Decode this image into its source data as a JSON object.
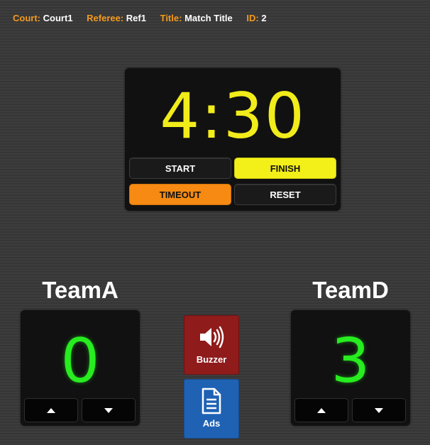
{
  "info": {
    "court_label": "Court:",
    "court_value": "Court1",
    "referee_label": "Referee:",
    "referee_value": "Ref1",
    "title_label": "Title:",
    "title_value": "Match Title",
    "id_label": "ID:",
    "id_value": "2"
  },
  "timer": {
    "display": "4:30",
    "start_label": "START",
    "finish_label": "FINISH",
    "timeout_label": "TIMEOUT",
    "reset_label": "RESET"
  },
  "team_left": {
    "name": "TeamA",
    "score": "0"
  },
  "team_right": {
    "name": "TeamD",
    "score": "3"
  },
  "actions": {
    "buzzer_label": "Buzzer",
    "buzzer_icon": "speaker-icon",
    "ads_label": "Ads",
    "ads_icon": "document-icon"
  },
  "colors": {
    "accent_orange": "#f39a1e",
    "clock_yellow": "#f1ec1a",
    "score_green": "#27ec1f",
    "buzzer_red": "#8f1b1b",
    "ads_blue": "#1f62b4"
  }
}
